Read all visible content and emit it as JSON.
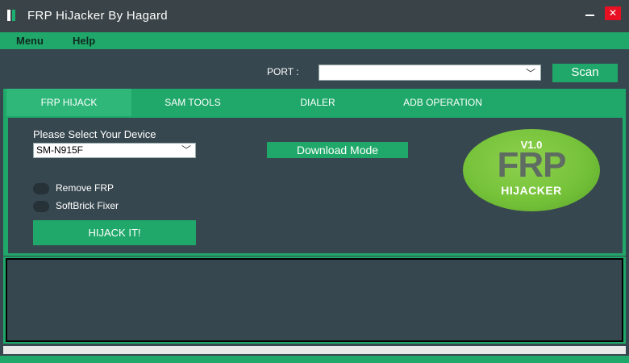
{
  "window": {
    "title": "FRP HiJacker By Hagard",
    "close_glyph": "✕"
  },
  "menu": {
    "items": [
      "Menu",
      "Help"
    ]
  },
  "port": {
    "label": "PORT :",
    "value": ""
  },
  "scan_label": "Scan",
  "tabs": [
    {
      "label": "FRP HIJACK",
      "active": true
    },
    {
      "label": "SAM TOOLS",
      "active": false
    },
    {
      "label": "DIALER",
      "active": false
    },
    {
      "label": "ADB OPERATION",
      "active": false
    }
  ],
  "device": {
    "label": "Please Select Your Device",
    "selected": "SM-N915F"
  },
  "options": [
    "Remove FRP",
    "SoftBrick Fixer"
  ],
  "hijack_label": "HIJACK IT!",
  "download_label": "Download Mode",
  "logo": {
    "version": "V1.0",
    "frp": "FRP",
    "hijacker": "HIJACKER"
  },
  "log": {
    "text": ""
  },
  "progress": {
    "value": 0
  },
  "colors": {
    "accent": "#20a86a",
    "background": "#37474f",
    "close": "#e81123"
  }
}
